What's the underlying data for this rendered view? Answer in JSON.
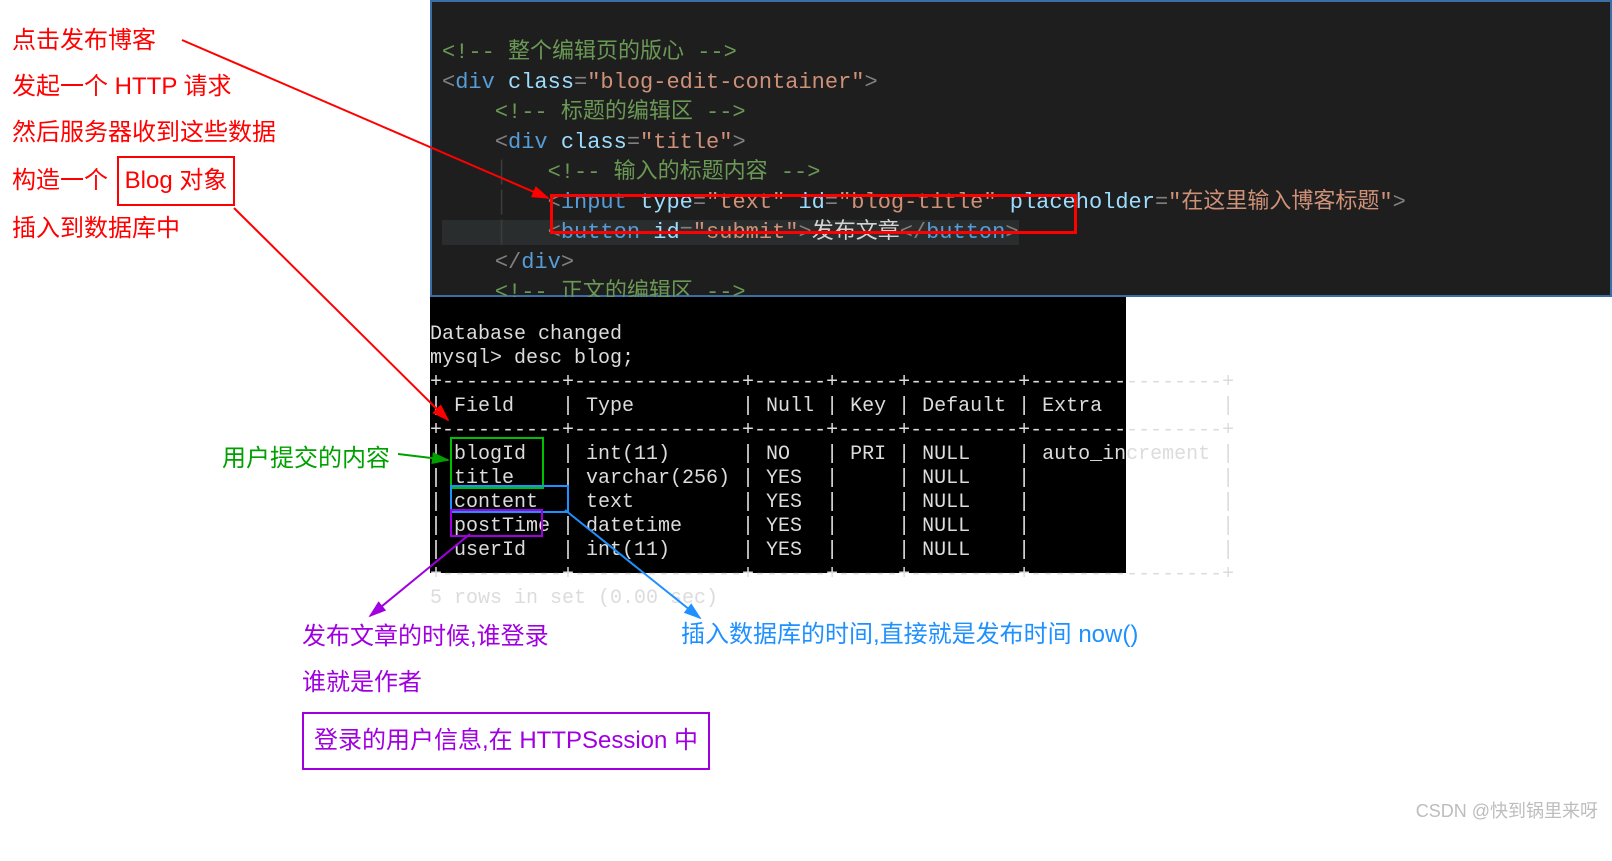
{
  "annotations": {
    "left": {
      "l1": "点击发布博客",
      "l2": "发起一个 HTTP 请求",
      "l3": "然后服务器收到这些数据",
      "l4_before": "构造一个 ",
      "l4_box": "Blog 对象",
      "l5": "插入到数据库中"
    },
    "green": "用户提交的内容",
    "blue": "插入数据库的时间,直接就是发布时间 now()",
    "purple": {
      "l1": "发布文章的时候,谁登录",
      "l2": "谁就是作者",
      "box": "登录的用户信息,在 HTTPSession 中"
    }
  },
  "watermark": "CSDN @快到锅里来呀",
  "code": {
    "comment_container": "<!-- 整个编辑页的版心 -->",
    "tag_div": "div",
    "attr_class": "class",
    "val_container": "\"blog-edit-container\"",
    "comment_title": "<!-- 标题的编辑区 -->",
    "val_title": "\"title\"",
    "comment_input": "<!-- 输入的标题内容 -->",
    "tag_input": "input",
    "attr_type": "type",
    "val_text": "\"text\"",
    "attr_id": "id",
    "val_blog_title": "\"blog-title\"",
    "attr_placeholder": "placeholder",
    "val_placeholder": "\"在这里输入博客标题\"",
    "tag_button": "button",
    "val_submit": "\"submit\"",
    "button_text": "发布文章",
    "comment_body": "<!-- 正文的编辑区 -->"
  },
  "sql": {
    "line_db": "Database changed",
    "prompt": "mysql> ",
    "cmd": "desc blog;",
    "sep_top": "+----------+--------------+------+-----+---------+----------------+",
    "hdr": "| Field    | Type         | Null | Key | Default | Extra          |",
    "sep_mid": "+----------+--------------+------+-----+---------+----------------+",
    "r1": "| blogId   | int(11)      | NO   | PRI | NULL    | auto_increment |",
    "r2": "| title    | varchar(256) | YES  |     | NULL    |                |",
    "r3": "| content  | text         | YES  |     | NULL    |                |",
    "r4": "| postTime | datetime     | YES  |     | NULL    |                |",
    "r5": "| userId   | int(11)      | YES  |     | NULL    |                |",
    "sep_bot": "+----------+--------------+------+-----+---------+----------------+",
    "footer": "5 rows in set (0.00 sec)"
  },
  "chart_data": {
    "type": "table",
    "title": "desc blog;",
    "columns": [
      "Field",
      "Type",
      "Null",
      "Key",
      "Default",
      "Extra"
    ],
    "rows": [
      [
        "blogId",
        "int(11)",
        "NO",
        "PRI",
        "NULL",
        "auto_increment"
      ],
      [
        "title",
        "varchar(256)",
        "YES",
        "",
        "NULL",
        ""
      ],
      [
        "content",
        "text",
        "YES",
        "",
        "NULL",
        ""
      ],
      [
        "postTime",
        "datetime",
        "YES",
        "",
        "NULL",
        ""
      ],
      [
        "userId",
        "int(11)",
        "YES",
        "",
        "NULL",
        ""
      ]
    ],
    "footer": "5 rows in set (0.00 sec)"
  }
}
